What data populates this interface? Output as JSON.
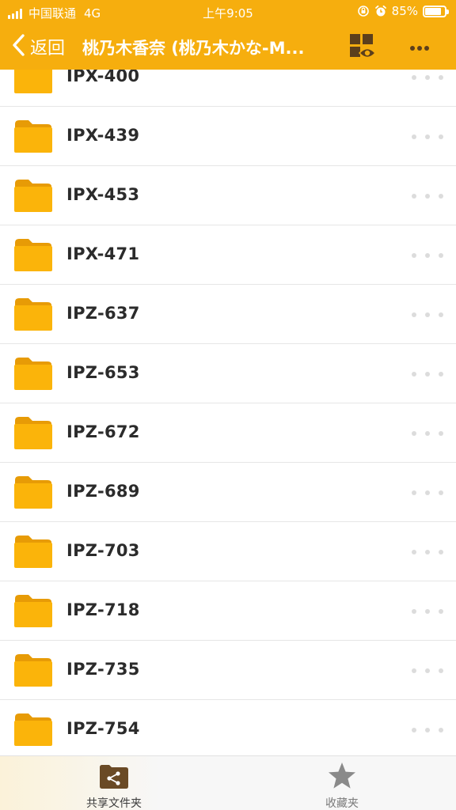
{
  "status_bar": {
    "carrier": "中国联通",
    "network": "4G",
    "time": "上午9:05",
    "battery_percent": "85%",
    "battery_level": 0.85
  },
  "nav": {
    "back_label": "返回",
    "title": "桃乃木香奈 (桃乃木かな-M...",
    "view_icon": "grid-eye-icon",
    "more_icon": "more-horizontal-icon"
  },
  "colors": {
    "accent": "#f6ae0e",
    "folder": "#fbb40a",
    "folder_tab": "#e79b06",
    "tab_active_icon": "#6a4a25",
    "tab_inactive_icon": "#8a8a8a"
  },
  "folders": [
    {
      "name": "IPX-400"
    },
    {
      "name": "IPX-439"
    },
    {
      "name": "IPX-453"
    },
    {
      "name": "IPX-471"
    },
    {
      "name": "IPZ-637"
    },
    {
      "name": "IPZ-653"
    },
    {
      "name": "IPZ-672"
    },
    {
      "name": "IPZ-689"
    },
    {
      "name": "IPZ-703"
    },
    {
      "name": "IPZ-718"
    },
    {
      "name": "IPZ-735"
    },
    {
      "name": "IPZ-754"
    }
  ],
  "tabs": [
    {
      "label": "共享文件夹",
      "icon": "shared-folder-icon",
      "active": true
    },
    {
      "label": "收藏夹",
      "icon": "star-icon",
      "active": false
    }
  ]
}
